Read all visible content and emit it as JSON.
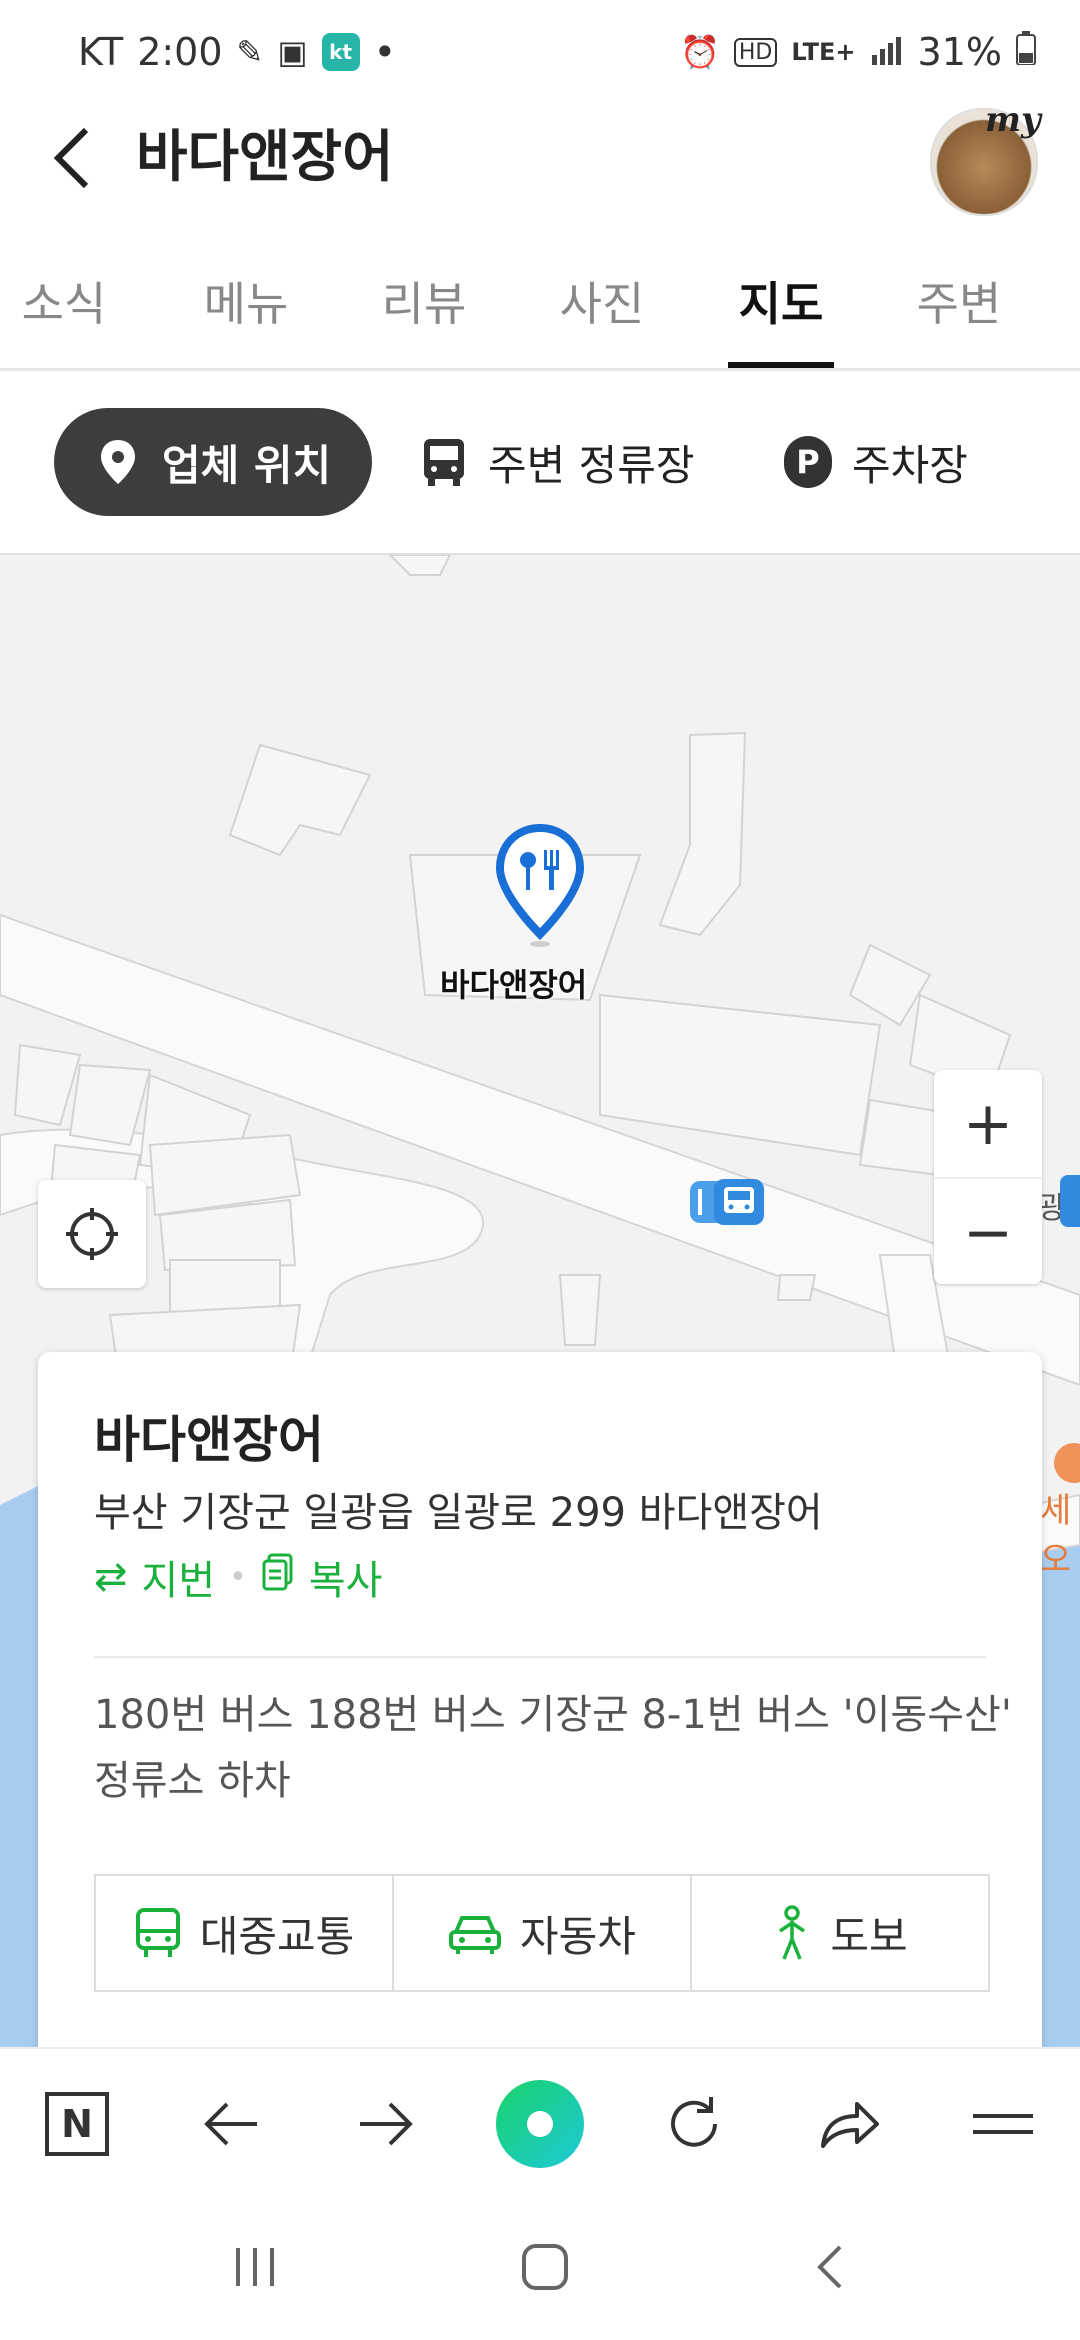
{
  "status_bar": {
    "carrier": "KT",
    "time": "2:00",
    "kt_badge": "kt",
    "dot": "•",
    "network": "LTE+",
    "battery": "31%"
  },
  "header": {
    "title": "바다앤장어",
    "back_icon": "chevron-left-icon",
    "my_label": "my"
  },
  "tabs": [
    {
      "label": "소식",
      "active": false
    },
    {
      "label": "메뉴",
      "active": false
    },
    {
      "label": "리뷰",
      "active": false
    },
    {
      "label": "사진",
      "active": false
    },
    {
      "label": "지도",
      "active": true
    },
    {
      "label": "주변",
      "active": false
    }
  ],
  "filters": [
    {
      "label": "업체 위치",
      "icon": "location-pin-icon",
      "active": true
    },
    {
      "label": "주변 정류장",
      "icon": "bus-icon",
      "active": false
    },
    {
      "label": "주차장",
      "icon": "parking-icon",
      "active": false
    }
  ],
  "map": {
    "pin_label": "바다앤장어",
    "pin_icon": "restaurant-icon",
    "zoom_in": "+",
    "zoom_out": "−",
    "edge_label_1": "광",
    "edge_label_2": "세오"
  },
  "card": {
    "title": "바다앤장어",
    "address": "부산 기장군 일광읍 일광로 299 바다앤장어",
    "lot_label": "지번",
    "copy_label": "복사",
    "bus_info": "180번 버스 188번 버스 기장군 8-1번 버스 '이동수산' 정류소 하차",
    "routes": [
      {
        "label": "대중교통",
        "icon": "bus-icon"
      },
      {
        "label": "자동차",
        "icon": "car-icon"
      },
      {
        "label": "도보",
        "icon": "walk-icon"
      }
    ]
  },
  "toolbar": {
    "home_letter": "N"
  },
  "colors": {
    "green": "#19b13c",
    "pin_blue": "#1a6fd6",
    "chip_dark": "#3d3d3d"
  }
}
